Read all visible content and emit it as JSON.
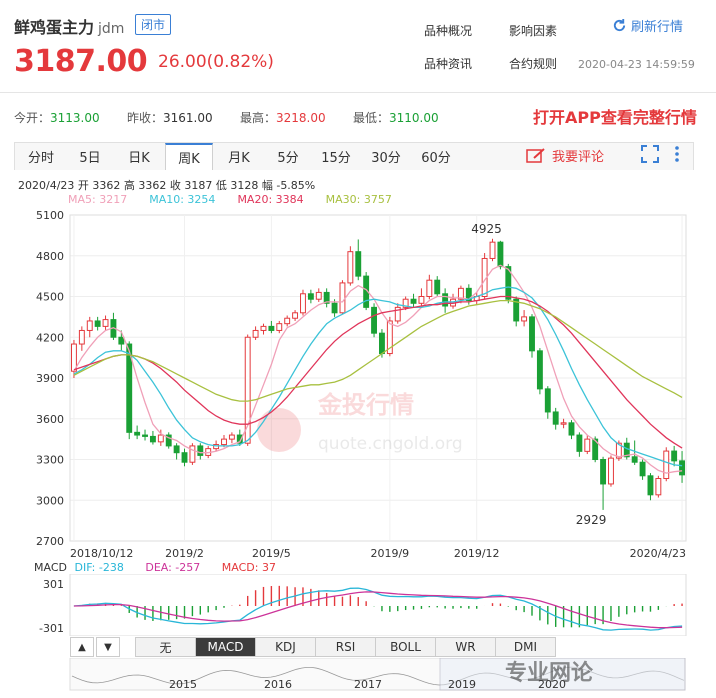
{
  "header": {
    "name": "鲜鸡蛋主力",
    "code": "jdm",
    "status_badge": "闭市",
    "price": "3187.00",
    "change": "26.00(0.82%)",
    "links": [
      "品种概况",
      "影响因素",
      "品种资讯",
      "合约规则"
    ],
    "refresh_label": "刷新行情",
    "timestamp": "2020-04-23 14:59:59"
  },
  "stats": {
    "open_label": "今开：",
    "open": "3113.00",
    "prev_label": "昨收：",
    "prev": "3161.00",
    "high_label": "最高：",
    "high": "3218.00",
    "low_label": "最低：",
    "low": "3110.00"
  },
  "open_app_label": "打开APP查看完整行情",
  "tabs": [
    "分时",
    "5日",
    "日K",
    "周K",
    "月K",
    "5分",
    "15分",
    "30分",
    "60分"
  ],
  "active_tab": "周K",
  "comment_label": "我要评论",
  "chart_info": "2020/4/23  开 3362  高 3362  收 3187  低 3128  幅 -5.85%",
  "ma_labels": {
    "ma5": "MA5: 3217",
    "ma10": "MA10: 3254",
    "ma20": "MA20: 3384",
    "ma30": "MA30: 3757"
  },
  "colors": {
    "up": "#e4393c",
    "down": "#1aa035",
    "ma5": "#f0a0b8",
    "ma10": "#3cc3d8",
    "ma20": "#e0355a",
    "ma30": "#a8c040",
    "dif": "#29b6d8",
    "dea": "#cc3399",
    "accent": "#3a7fd5"
  },
  "watermark": {
    "logo_text": "金投行情",
    "url": "quote.cngold.org"
  },
  "forum_watermark": "专业网论",
  "indicator_tabs": [
    "无",
    "MACD",
    "KDJ",
    "RSI",
    "BOLL",
    "WR",
    "DMI"
  ],
  "active_indicator": "MACD",
  "nav_buttons": [
    "▲",
    "▼"
  ],
  "macd": {
    "label": "MACD",
    "dif": "DIF: -238",
    "dea": "DEA: -257",
    "macd": "MACD: 37",
    "y_ticks": [
      "301",
      "-301"
    ]
  },
  "navigator_years": [
    "2015",
    "2016",
    "2017",
    "2019",
    "2020"
  ],
  "chart_data": {
    "type": "candlestick",
    "y_ticks": [
      5100,
      4800,
      4500,
      4200,
      3900,
      3600,
      3300,
      3000,
      2700
    ],
    "ylim": [
      2700,
      5100
    ],
    "x_ticks": [
      "2018/10/12",
      "2019/2",
      "2019/5",
      "2019/9",
      "2019/12",
      "2020/4/23"
    ],
    "annotations": [
      {
        "text": "4925",
        "value": 4925
      },
      {
        "text": "2929",
        "value": 2929
      }
    ],
    "candles": [
      [
        3950,
        4150,
        3900,
        4180
      ],
      [
        4150,
        4250,
        4100,
        4280
      ],
      [
        4250,
        4320,
        4200,
        4350
      ],
      [
        4320,
        4280,
        4250,
        4350
      ],
      [
        4280,
        4330,
        4250,
        4360
      ],
      [
        4330,
        4200,
        4180,
        4380
      ],
      [
        4200,
        4150,
        4100,
        4250
      ],
      [
        4150,
        3500,
        3450,
        4170
      ],
      [
        3500,
        3480,
        3450,
        3550
      ],
      [
        3480,
        3470,
        3440,
        3520
      ],
      [
        3470,
        3430,
        3410,
        3510
      ],
      [
        3430,
        3480,
        3400,
        3520
      ],
      [
        3480,
        3400,
        3380,
        3500
      ],
      [
        3400,
        3350,
        3300,
        3420
      ],
      [
        3350,
        3280,
        3250,
        3380
      ],
      [
        3280,
        3400,
        3260,
        3420
      ],
      [
        3400,
        3330,
        3300,
        3420
      ],
      [
        3330,
        3380,
        3310,
        3400
      ],
      [
        3380,
        3410,
        3360,
        3440
      ],
      [
        3410,
        3450,
        3390,
        3480
      ],
      [
        3450,
        3480,
        3420,
        3500
      ],
      [
        3480,
        3420,
        3400,
        3520
      ],
      [
        3420,
        4200,
        3400,
        4220
      ],
      [
        4200,
        4250,
        4180,
        4280
      ],
      [
        4250,
        4280,
        4220,
        4300
      ],
      [
        4280,
        4250,
        4230,
        4320
      ],
      [
        4250,
        4300,
        4230,
        4320
      ],
      [
        4300,
        4340,
        4280,
        4360
      ],
      [
        4340,
        4380,
        4320,
        4400
      ],
      [
        4380,
        4520,
        4360,
        4550
      ],
      [
        4520,
        4480,
        4450,
        4550
      ],
      [
        4480,
        4530,
        4460,
        4560
      ],
      [
        4530,
        4450,
        4420,
        4560
      ],
      [
        4450,
        4380,
        4350,
        4480
      ],
      [
        4380,
        4600,
        4370,
        4620
      ],
      [
        4600,
        4830,
        4580,
        4870
      ],
      [
        4830,
        4650,
        4620,
        4920
      ],
      [
        4650,
        4420,
        4400,
        4680
      ],
      [
        4420,
        4230,
        4200,
        4450
      ],
      [
        4230,
        4080,
        4050,
        4260
      ],
      [
        4080,
        4320,
        4060,
        4350
      ],
      [
        4320,
        4420,
        4300,
        4450
      ],
      [
        4420,
        4480,
        4400,
        4500
      ],
      [
        4480,
        4450,
        4420,
        4520
      ],
      [
        4450,
        4500,
        4430,
        4560
      ],
      [
        4500,
        4620,
        4480,
        4660
      ],
      [
        4620,
        4520,
        4500,
        4650
      ],
      [
        4520,
        4430,
        4380,
        4560
      ],
      [
        4430,
        4480,
        4410,
        4520
      ],
      [
        4480,
        4560,
        4450,
        4580
      ],
      [
        4560,
        4470,
        4440,
        4590
      ],
      [
        4470,
        4500,
        4440,
        4530
      ],
      [
        4500,
        4780,
        4480,
        4820
      ],
      [
        4780,
        4900,
        4760,
        4925
      ],
      [
        4900,
        4720,
        4700,
        4910
      ],
      [
        4720,
        4480,
        4450,
        4740
      ],
      [
        4480,
        4320,
        4280,
        4500
      ],
      [
        4320,
        4350,
        4280,
        4400
      ],
      [
        4350,
        4100,
        4050,
        4370
      ],
      [
        4100,
        3820,
        3780,
        4120
      ],
      [
        3820,
        3650,
        3600,
        3840
      ],
      [
        3650,
        3560,
        3520,
        3680
      ],
      [
        3560,
        3570,
        3530,
        3600
      ],
      [
        3570,
        3480,
        3450,
        3590
      ],
      [
        3480,
        3360,
        3320,
        3500
      ],
      [
        3360,
        3450,
        3340,
        3480
      ],
      [
        3450,
        3300,
        3280,
        3470
      ],
      [
        3300,
        3120,
        2929,
        3320
      ],
      [
        3120,
        3310,
        3100,
        3330
      ],
      [
        3310,
        3420,
        3290,
        3440
      ],
      [
        3420,
        3320,
        3300,
        3460
      ],
      [
        3320,
        3280,
        3260,
        3440
      ],
      [
        3280,
        3180,
        3150,
        3300
      ],
      [
        3180,
        3040,
        3000,
        3200
      ],
      [
        3040,
        3160,
        3020,
        3180
      ],
      [
        3160,
        3362,
        3140,
        3390
      ],
      [
        3362,
        3290,
        3250,
        3400
      ],
      [
        3290,
        3187,
        3128,
        3362
      ]
    ],
    "ma5": [
      3950,
      4050,
      4130,
      4200,
      4250,
      4270,
      4240,
      4100,
      3900,
      3720,
      3560,
      3490,
      3460,
      3440,
      3400,
      3370,
      3350,
      3350,
      3360,
      3380,
      3410,
      3430,
      3550,
      3700,
      3850,
      4000,
      4180,
      4270,
      4300,
      4350,
      4400,
      4440,
      4460,
      4460,
      4460,
      4540,
      4580,
      4550,
      4480,
      4380,
      4300,
      4280,
      4310,
      4360,
      4420,
      4470,
      4500,
      4500,
      4490,
      4490,
      4480,
      4530,
      4620,
      4700,
      4730,
      4700,
      4620,
      4530,
      4420,
      4280,
      4100,
      3920,
      3750,
      3620,
      3540,
      3480,
      3440,
      3380,
      3340,
      3320,
      3330,
      3340,
      3310,
      3260,
      3220,
      3200,
      3210,
      3217
    ],
    "ma10": [
      3930,
      3960,
      4000,
      4050,
      4090,
      4100,
      4100,
      4080,
      4030,
      3950,
      3870,
      3780,
      3680,
      3590,
      3520,
      3460,
      3430,
      3410,
      3400,
      3400,
      3400,
      3410,
      3440,
      3500,
      3580,
      3670,
      3760,
      3860,
      3960,
      4060,
      4150,
      4230,
      4300,
      4340,
      4370,
      4400,
      4440,
      4470,
      4480,
      4470,
      4460,
      4440,
      4430,
      4420,
      4420,
      4430,
      4450,
      4460,
      4460,
      4470,
      4480,
      4500,
      4520,
      4550,
      4560,
      4570,
      4560,
      4530,
      4490,
      4420,
      4330,
      4220,
      4100,
      3970,
      3850,
      3740,
      3640,
      3540,
      3460,
      3410,
      3380,
      3360,
      3340,
      3320,
      3300,
      3280,
      3260,
      3254
    ],
    "ma20": [
      3960,
      3980,
      4000,
      4020,
      4040,
      4060,
      4070,
      4070,
      4060,
      4040,
      4010,
      3970,
      3920,
      3870,
      3810,
      3760,
      3710,
      3660,
      3620,
      3590,
      3570,
      3560,
      3560,
      3580,
      3610,
      3650,
      3700,
      3760,
      3830,
      3900,
      3970,
      4040,
      4110,
      4170,
      4220,
      4260,
      4300,
      4330,
      4360,
      4380,
      4390,
      4400,
      4410,
      4420,
      4430,
      4440,
      4440,
      4450,
      4450,
      4460,
      4460,
      4470,
      4480,
      4490,
      4500,
      4500,
      4490,
      4480,
      4460,
      4430,
      4390,
      4340,
      4290,
      4230,
      4160,
      4090,
      4020,
      3950,
      3880,
      3810,
      3740,
      3680,
      3620,
      3560,
      3510,
      3460,
      3420,
      3384
    ],
    "ma30": [
      3920,
      3950,
      3980,
      4010,
      4040,
      4060,
      4070,
      4070,
      4060,
      4040,
      4020,
      3990,
      3960,
      3930,
      3900,
      3870,
      3840,
      3810,
      3780,
      3760,
      3740,
      3730,
      3730,
      3740,
      3760,
      3780,
      3800,
      3820,
      3830,
      3840,
      3850,
      3850,
      3860,
      3870,
      3890,
      3920,
      3960,
      4000,
      4040,
      4080,
      4120,
      4160,
      4200,
      4240,
      4280,
      4310,
      4340,
      4370,
      4390,
      4410,
      4430,
      4440,
      4450,
      4460,
      4470,
      4470,
      4460,
      4450,
      4430,
      4410,
      4380,
      4350,
      4310,
      4270,
      4230,
      4190,
      4150,
      4110,
      4070,
      4030,
      3990,
      3950,
      3910,
      3880,
      3850,
      3820,
      3790,
      3757
    ]
  }
}
